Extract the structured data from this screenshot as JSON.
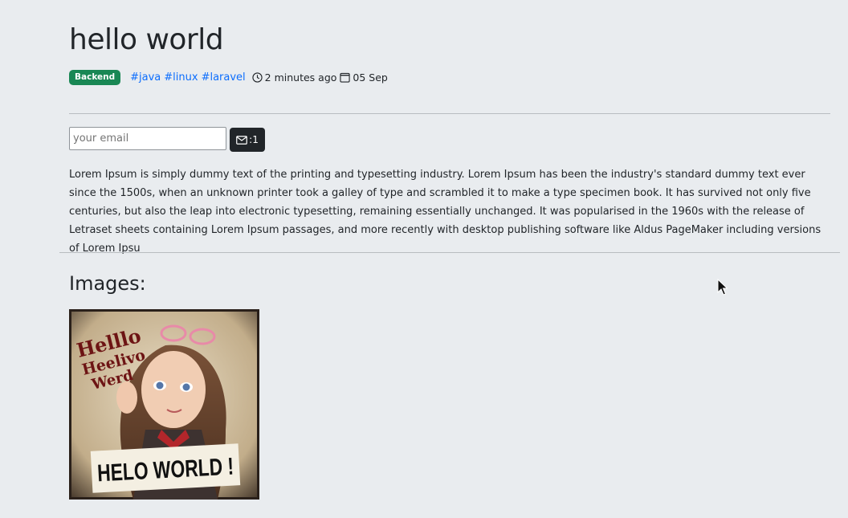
{
  "post": {
    "title": "hello world",
    "category": "Backend",
    "tags": [
      "#java",
      "#linux",
      "#laravel"
    ],
    "time_ago": "2 minutes ago",
    "date": "05 Sep",
    "body": "Lorem Ipsum is simply dummy text of the printing and typesetting industry. Lorem Ipsum has been the industry's standard dummy text ever since the 1500s, when an unknown printer took a galley of type and scrambled it to make a type specimen book. It has survived not only five centuries, but also the leap into electronic typesetting, remaining essentially unchanged. It was popularised in the 1960s with the release of Letraset sheets containing Lorem Ipsum passages, and more recently with desktop publishing software like Aldus PageMaker including versions of Lorem Ipsu"
  },
  "subscribe": {
    "placeholder": "your email",
    "button_label": ":1"
  },
  "images": {
    "heading": "Images:",
    "items": [
      {
        "sign_text": "HELO WORLD !",
        "handwritten_text": [
          "Helllo",
          "Heelivo",
          "Werd"
        ]
      }
    ]
  },
  "colors": {
    "background": "#e9ecef",
    "badge": "#198754",
    "link": "#0d6efd",
    "button": "#212529"
  },
  "icons": {
    "time": "clock-icon",
    "date": "calendar-icon",
    "subscribe": "envelope-icon"
  }
}
